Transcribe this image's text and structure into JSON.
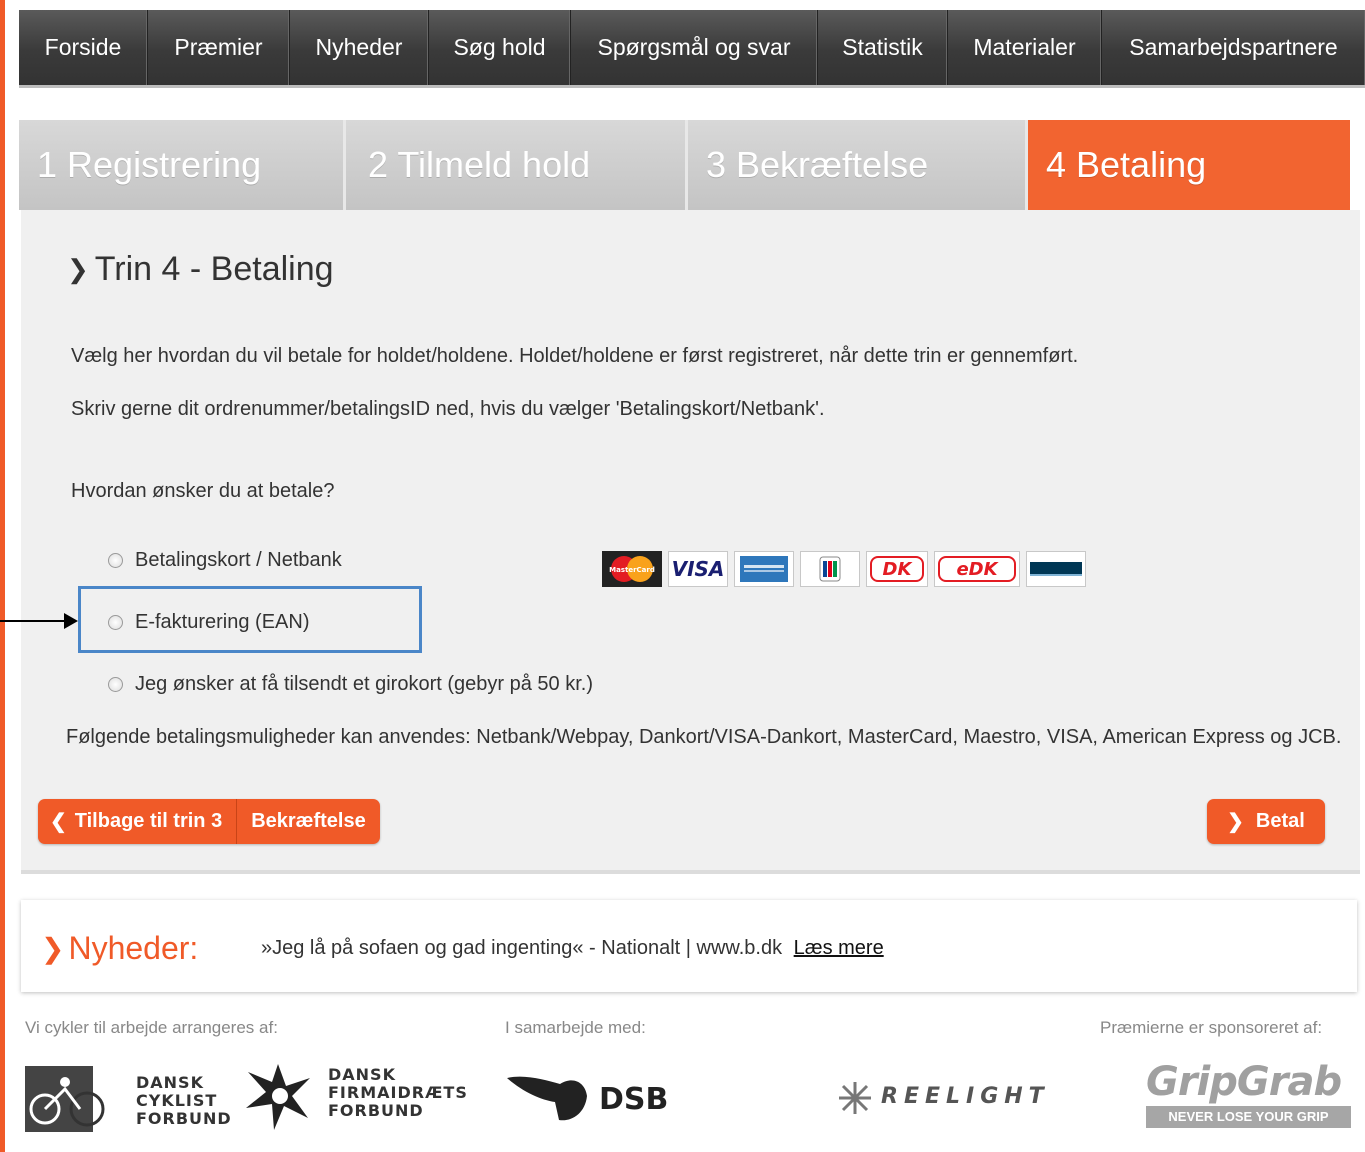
{
  "nav": {
    "items": [
      "Forside",
      "Præmier",
      "Nyheder",
      "Søg hold",
      "Spørgsmål og svar",
      "Statistik",
      "Materialer",
      "Samarbejdspartnere"
    ]
  },
  "steps": [
    {
      "label": "1 Registrering",
      "active": false
    },
    {
      "label": "2 Tilmeld hold",
      "active": false
    },
    {
      "label": "3 Bekræftelse",
      "active": false
    },
    {
      "label": "4 Betaling",
      "active": true
    }
  ],
  "main": {
    "title": "Trin 4 - Betaling",
    "intro1": "Vælg her hvordan du vil betale for holdet/holdene. Holdet/holdene er først registreret, når dette trin er gennemført.",
    "intro2": "Skriv gerne dit ordrenummer/betalingsID ned, hvis du vælger 'Betalingskort/Netbank'.",
    "question": "Hvordan ønsker du at betale?",
    "options": [
      {
        "label": "Betalingskort / Netbank",
        "selected": false
      },
      {
        "label": "E-fakturering (EAN)",
        "selected": false
      },
      {
        "label": "Jeg ønsker at få tilsendt et girokort (gebyr på 50 kr.)",
        "selected": false
      }
    ],
    "payment_info": "Følgende betalingsmuligheder kan anvendes: Netbank/Webpay, Dankort/VISA-Dankort, MasterCard, Maestro, VISA, American Express og JCB.",
    "cards": {
      "mastercard": "MasterCard",
      "visa": "VISA",
      "dk": "DK",
      "edk": "eDK"
    },
    "back_button": "Tilbage til trin 3",
    "confirm_button": "Bekræftelse",
    "pay_button": "Betal"
  },
  "news": {
    "label": "Nyheder:",
    "text": "»Jeg lå på sofaen og gad ingenting« - Nationalt | www.b.dk",
    "more": "Læs mere"
  },
  "footer": {
    "organized_by": "Vi cykler til arbejde arrangeres af:",
    "in_cooperation": "I samarbejde med:",
    "sponsored_by": "Præmierne er sponsoreret af:",
    "dcf": [
      "DANSK",
      "CYKLIST",
      "FORBUND"
    ],
    "dfif": [
      "DANSK",
      "FIRMAIDRÆTS",
      "FORBUND"
    ],
    "dsb": "DSB",
    "reelight": "REELIGHT",
    "gripgrab": "GripGrab",
    "gripgrab_tag": "NEVER LOSE YOUR GRIP"
  },
  "colors": {
    "accent": "#f05a28",
    "highlight": "#4a86c8",
    "nav_bg": "#3a3a3a"
  }
}
